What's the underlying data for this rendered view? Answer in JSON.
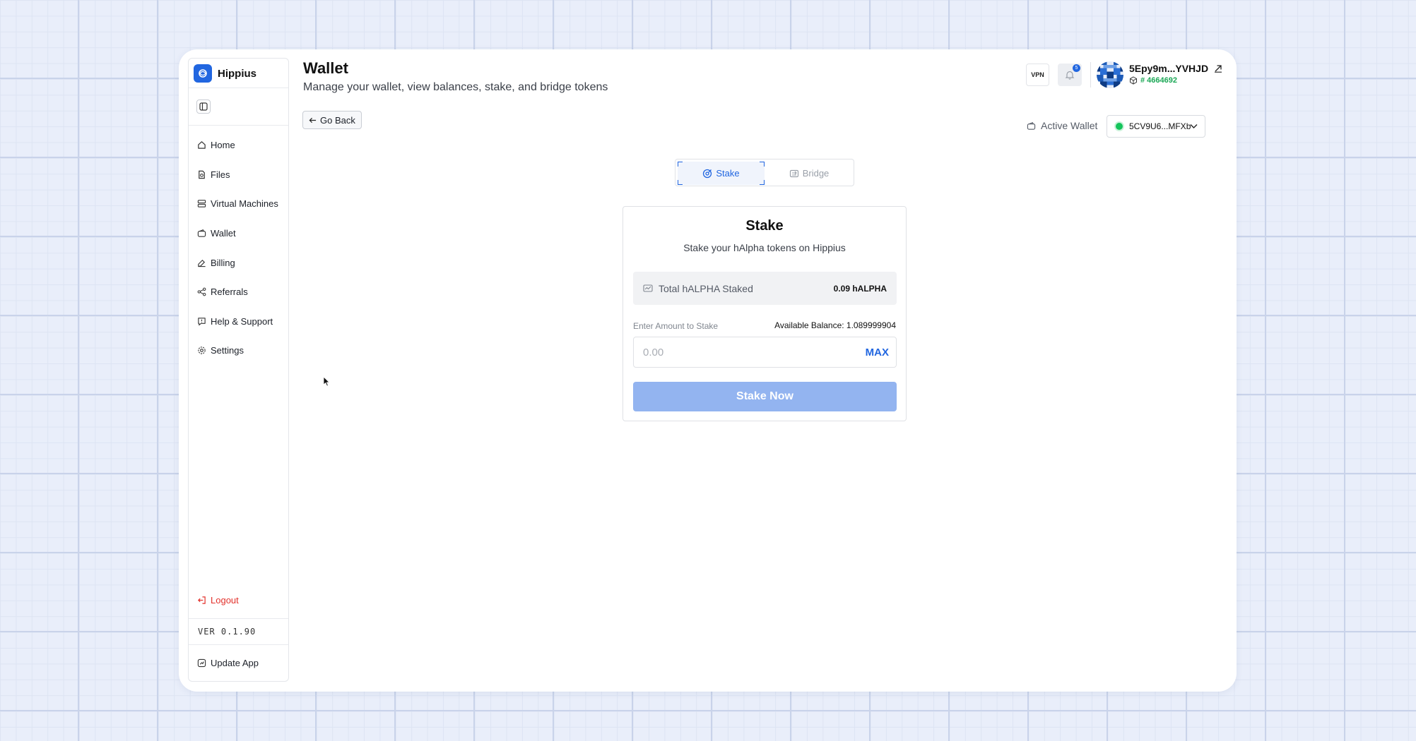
{
  "app": {
    "name": "Hippius",
    "accent_color": "#2166e0"
  },
  "sidebar": {
    "items": [
      {
        "label": "Home",
        "icon": "home-icon"
      },
      {
        "label": "Files",
        "icon": "file-icon"
      },
      {
        "label": "Virtual Machines",
        "icon": "server-icon"
      },
      {
        "label": "Wallet",
        "icon": "wallet-icon"
      },
      {
        "label": "Billing",
        "icon": "billing-icon"
      },
      {
        "label": "Referrals",
        "icon": "share-icon"
      },
      {
        "label": "Help & Support",
        "icon": "help-icon"
      },
      {
        "label": "Settings",
        "icon": "gear-icon"
      }
    ],
    "logout_label": "Logout",
    "version": "VER 0.1.90",
    "update_label": "Update App"
  },
  "header": {
    "title": "Wallet",
    "subtitle": "Manage your wallet, view balances, stake, and bridge tokens",
    "go_back_label": "Go Back",
    "vpn_label": "VPN",
    "notification_count": "5",
    "account_name": "5Epy9m...YVHJD",
    "account_block": "# 4664692",
    "active_wallet_label": "Active Wallet",
    "active_wallet_value": "5CV9U6...MFXb"
  },
  "tabs": [
    {
      "label": "Stake",
      "active": true
    },
    {
      "label": "Bridge",
      "active": false
    }
  ],
  "stake_card": {
    "title": "Stake",
    "subtitle": "Stake your hAlpha tokens on Hippius",
    "total_staked_label": "Total hALPHA Staked",
    "total_staked_value": "0.09 hALPHA",
    "amount_label": "Enter Amount to Stake",
    "available_balance": "Available Balance: 1.089999904",
    "amount_placeholder": "0.00",
    "amount_value": "",
    "max_label": "MAX",
    "submit_label": "Stake Now"
  }
}
